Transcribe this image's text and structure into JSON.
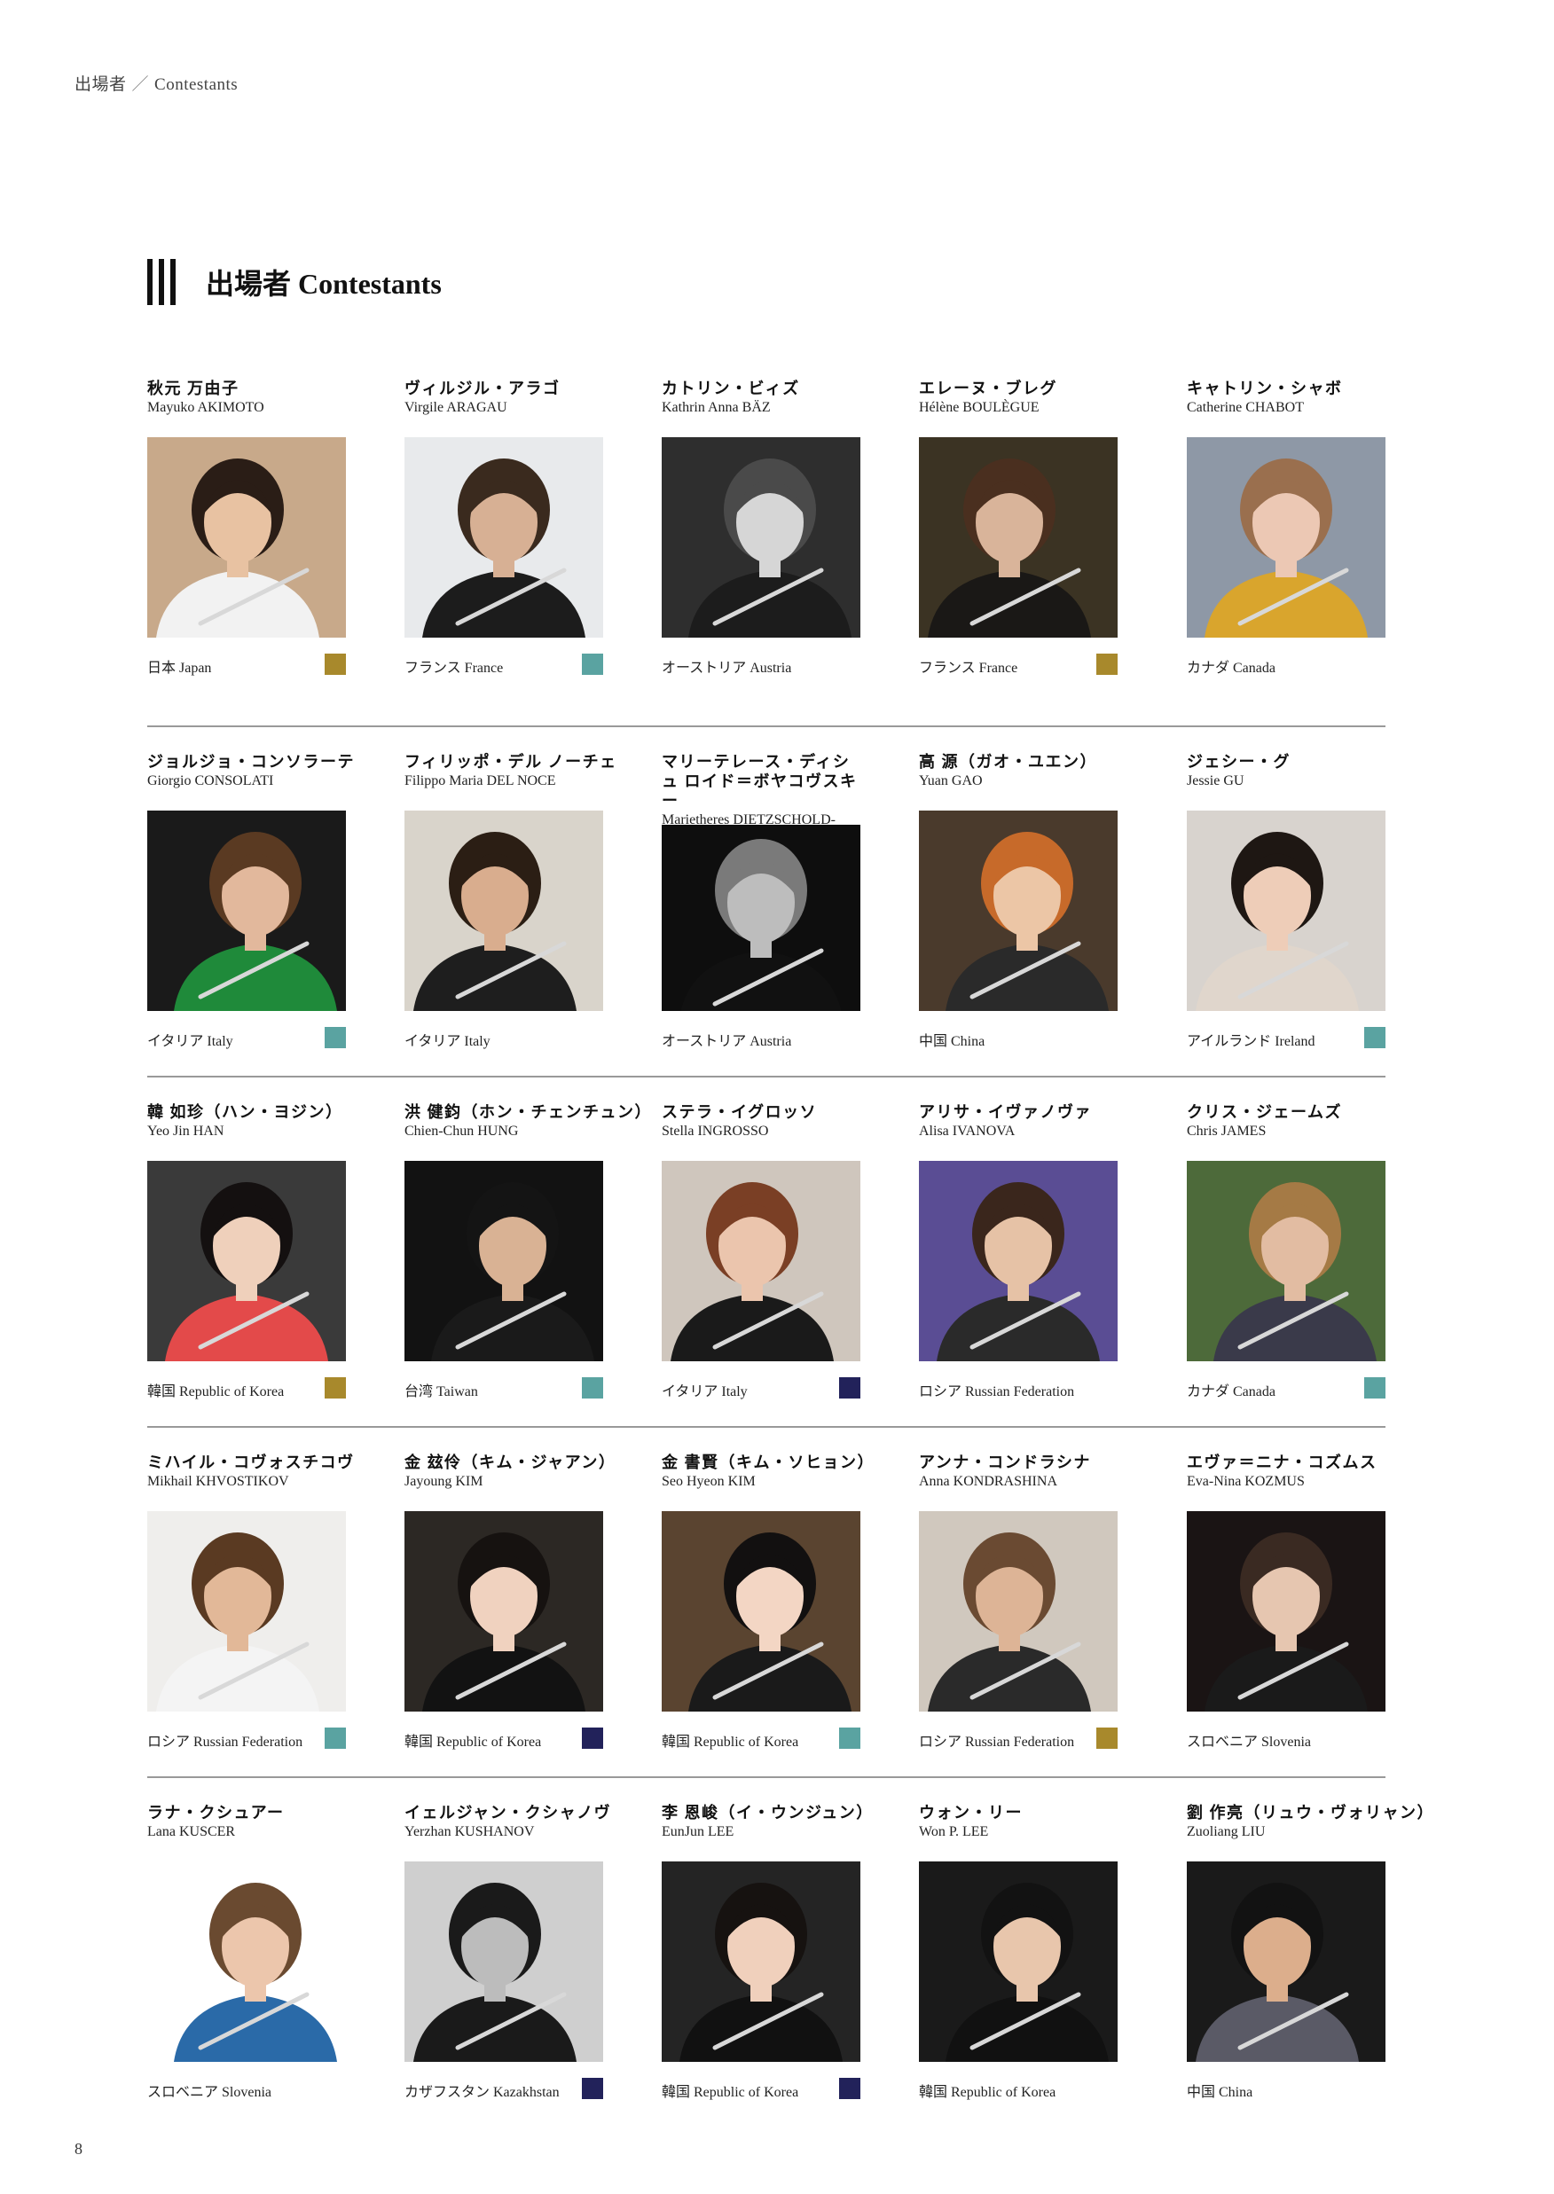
{
  "running_head": {
    "jp": "出場者",
    "sep": "／",
    "en": "Contestants"
  },
  "section_title": "出場者 Contestants",
  "rows": [
    [
      {
        "jp": "秋元 万由子",
        "en": "Mayuko AKIMOTO",
        "country": "日本 Japan",
        "swatch": "#a8892c",
        "photo": {
          "bg": "#c8a98a",
          "skin": "#e8c2a2",
          "hair": "#2a1d16",
          "top": "#f2f2f2"
        }
      },
      {
        "jp": "ヴィルジル・アラゴ",
        "en": "Virgile ARAGAU",
        "country": "フランス France",
        "swatch": "#5aa3a1",
        "photo": {
          "bg": "#e8eaec",
          "skin": "#d7b094",
          "hair": "#3a2a1e",
          "top": "#1c1c1c"
        }
      },
      {
        "jp": "カトリン・ビィズ",
        "en": "Kathrin Anna BÄZ",
        "country": "オーストリア Austria",
        "swatch": null,
        "photo": {
          "bg": "#2e2e2e",
          "skin": "#d6d6d6",
          "hair": "#4a4a4a",
          "top": "#1c1c1c"
        }
      },
      {
        "jp": "エレーヌ・ブレグ",
        "en": "Hélène BOULÈGUE",
        "country": "フランス France",
        "swatch": "#a8892c",
        "photo": {
          "bg": "#3b3323",
          "skin": "#d9b49a",
          "hair": "#4a2f1f",
          "top": "#1a1816"
        }
      },
      {
        "jp": "キャトリン・シャボ",
        "en": "Catherine CHABOT",
        "country": "カナダ Canada",
        "swatch": null,
        "photo": {
          "bg": "#8e98a6",
          "skin": "#ecc8b4",
          "hair": "#9a6f4e",
          "top": "#d9a52d"
        }
      }
    ],
    [
      {
        "jp": "ジョルジョ・コンソラーテ",
        "en": "Giorgio CONSOLATI",
        "country": "イタリア Italy",
        "swatch": "#5aa3a1",
        "photo": {
          "bg": "#1a1a1a",
          "skin": "#e2b89c",
          "hair": "#5a3a22",
          "top": "#1f8a3a"
        }
      },
      {
        "jp": "フィリッポ・デル ノーチェ",
        "en": "Filippo Maria DEL NOCE",
        "country": "イタリア Italy",
        "swatch": null,
        "photo": {
          "bg": "#d9d4cb",
          "skin": "#d9ad8e",
          "hair": "#2b1e14",
          "top": "#1e1e1e"
        }
      },
      {
        "jp": "マリーテレース・ディシュ ロイド＝ボヤコヴスキー",
        "en": "Marietheres DIETZSCHOLD-BOJAKOVSKY",
        "country": "オーストリア Austria",
        "swatch": null,
        "tall": true,
        "photo": {
          "bg": "#0e0e0e",
          "skin": "#bdbdbd",
          "hair": "#7a7a7a",
          "top": "#111111"
        }
      },
      {
        "jp": "高 源（ガオ・ユエン）",
        "en": "Yuan GAO",
        "country": "中国 China",
        "swatch": null,
        "photo": {
          "bg": "#4a3a2c",
          "skin": "#ecc6a6",
          "hair": "#c76a2a",
          "top": "#2a2a2a"
        }
      },
      {
        "jp": "ジェシー・グ",
        "en": "Jessie GU",
        "country": "アイルランド Ireland",
        "swatch": "#5aa3a1",
        "photo": {
          "bg": "#d8d3ce",
          "skin": "#eecdb8",
          "hair": "#1e1713",
          "top": "#e0d6cc"
        }
      }
    ],
    [
      {
        "jp": "韓 如珍（ハン・ヨジン）",
        "en": "Yeo Jin HAN",
        "country": "韓国 Republic of Korea",
        "swatch": "#a8892c",
        "photo": {
          "bg": "#3a3a3a",
          "skin": "#efd0bb",
          "hair": "#141010",
          "top": "#e34a4a"
        }
      },
      {
        "jp": "洪 健鈞（ホン・チェンチュン）",
        "en": "Chien-Chun HUNG",
        "country": "台湾 Taiwan",
        "swatch": "#5aa3a1",
        "photo": {
          "bg": "#121212",
          "skin": "#d9b294",
          "hair": "#141414",
          "top": "#1a1a1a"
        }
      },
      {
        "jp": "ステラ・イグロッソ",
        "en": "Stella INGROSSO",
        "country": "イタリア Italy",
        "swatch": "#22225a",
        "photo": {
          "bg": "#cfc6bd",
          "skin": "#ebc5ad",
          "hair": "#7a3f25",
          "top": "#1a1a1a"
        }
      },
      {
        "jp": "アリサ・イヴァノヴァ",
        "en": "Alisa IVANOVA",
        "country": "ロシア Russian Federation",
        "swatch": null,
        "photo": {
          "bg": "#5a4d94",
          "skin": "#e6c2a6",
          "hair": "#3a261c",
          "top": "#2a2a2a"
        }
      },
      {
        "jp": "クリス・ジェームズ",
        "en": "Chris JAMES",
        "country": "カナダ Canada",
        "swatch": "#5aa3a1",
        "photo": {
          "bg": "#4d6a3a",
          "skin": "#e2bca2",
          "hair": "#a57a45",
          "top": "#3a3a4a"
        }
      }
    ],
    [
      {
        "jp": "ミハイル・コヴォスチコヴ",
        "en": "Mikhail KHVOSTIKOV",
        "country": "ロシア Russian Federation",
        "swatch": "#5aa3a1",
        "photo": {
          "bg": "#efeeec",
          "skin": "#e2b898",
          "hair": "#5a3a22",
          "top": "#f4f4f4"
        }
      },
      {
        "jp": "金 玆伶（キム・ジャアン）",
        "en": "Jayoung KIM",
        "country": "韓国 Republic of Korea",
        "swatch": "#22225a",
        "photo": {
          "bg": "#2c2824",
          "skin": "#f0d2bf",
          "hair": "#161210",
          "top": "#121212"
        }
      },
      {
        "jp": "金 書賢（キム・ソヒョン）",
        "en": "Seo Hyeon KIM",
        "country": "韓国 Republic of Korea",
        "swatch": "#5aa3a1",
        "photo": {
          "bg": "#5a4430",
          "skin": "#f3d6c4",
          "hair": "#121010",
          "top": "#1a1a1a"
        }
      },
      {
        "jp": "アンナ・コンドラシナ",
        "en": "Anna KONDRASHINA",
        "country": "ロシア Russian Federation",
        "swatch": "#a8892c",
        "photo": {
          "bg": "#d0c8be",
          "skin": "#ddb496",
          "hair": "#6a4a32",
          "top": "#2a2a2a"
        }
      },
      {
        "jp": "エヴァ＝ニナ・コズムス",
        "en": "Eva-Nina KOZMUS",
        "country": "スロベニア Slovenia",
        "swatch": null,
        "photo": {
          "bg": "#1a1414",
          "skin": "#e6c6b0",
          "hair": "#3a2a22",
          "top": "#1a1a1a"
        }
      }
    ],
    [
      {
        "jp": "ラナ・クシュアー",
        "en": "Lana KUSCER",
        "country": "スロベニア Slovenia",
        "swatch": null,
        "photo": {
          "bg": "#ffffff",
          "skin": "#ecc6ac",
          "hair": "#6a4a30",
          "top": "#2a6aa8"
        }
      },
      {
        "jp": "イェルジャン・クシャノヴ",
        "en": "Yerzhan KUSHANOV",
        "country": "カザフスタン Kazakhstan",
        "swatch": "#22225a",
        "photo": {
          "bg": "#cfcfcf",
          "skin": "#bcbcbc",
          "hair": "#1a1a1a",
          "top": "#1a1a1a"
        }
      },
      {
        "jp": "李 恩峻（イ・ウンジュン）",
        "en": "EunJun LEE",
        "country": "韓国 Republic of Korea",
        "swatch": "#22225a",
        "photo": {
          "bg": "#242424",
          "skin": "#f0d0bc",
          "hair": "#161210",
          "top": "#111111"
        }
      },
      {
        "jp": "ウォン・リー",
        "en": "Won P. LEE",
        "country": "韓国 Republic of Korea",
        "swatch": null,
        "photo": {
          "bg": "#1a1a1a",
          "skin": "#e8c6ac",
          "hair": "#121212",
          "top": "#111111"
        }
      },
      {
        "jp": "劉 作亮（リュウ・ヴォリャン）",
        "en": "Zuoliang LIU",
        "country": "中国 China",
        "swatch": null,
        "photo": {
          "bg": "#1a1a1a",
          "skin": "#dcae8c",
          "hair": "#121212",
          "top": "#5a5a66"
        }
      }
    ]
  ],
  "folio": "8"
}
